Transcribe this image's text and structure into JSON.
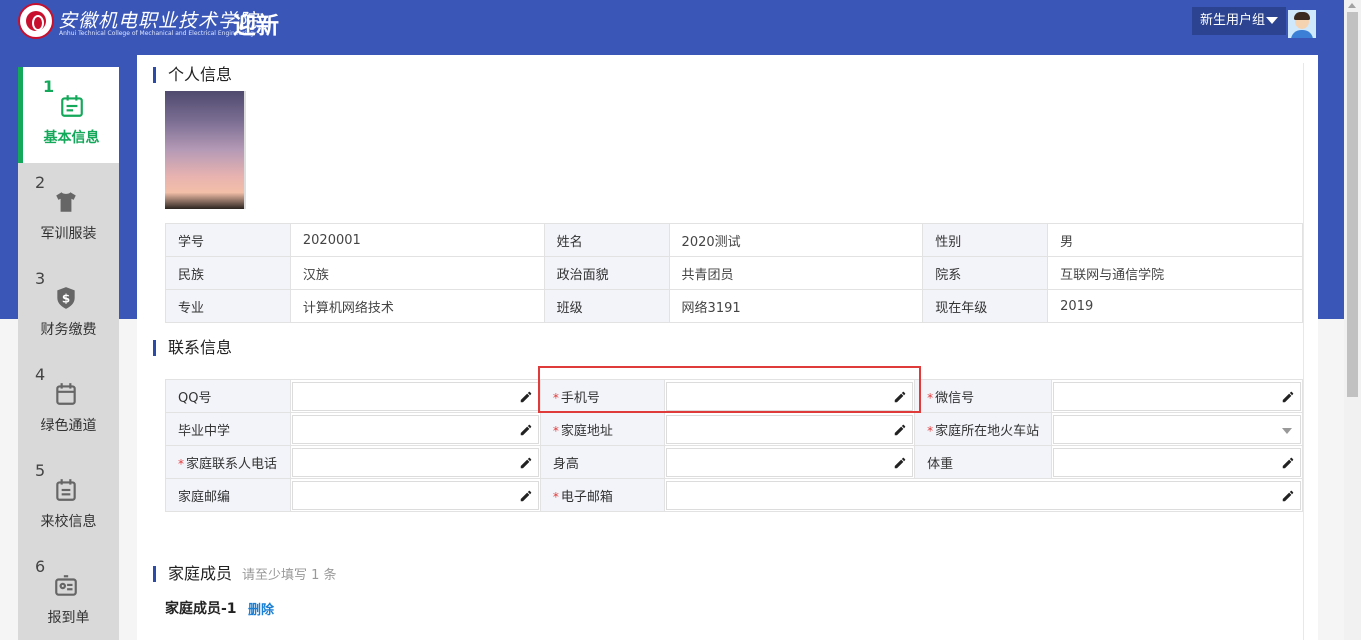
{
  "header": {
    "school_name": "安徽机电职业技术学院",
    "school_name_en": "Anhui Technical College of Mechanical and Electrical Engineering",
    "app_name": "迎新",
    "user_group": "新生用户组"
  },
  "sidebar": {
    "steps": [
      {
        "num": "1",
        "label": "基本信息",
        "icon": "calendar-edit-icon"
      },
      {
        "num": "2",
        "label": "军训服装",
        "icon": "tshirt-icon"
      },
      {
        "num": "3",
        "label": "财务缴费",
        "icon": "dollar-shield-icon"
      },
      {
        "num": "4",
        "label": "绿色通道",
        "icon": "calendar-icon"
      },
      {
        "num": "5",
        "label": "来校信息",
        "icon": "calendar-list-icon"
      },
      {
        "num": "6",
        "label": "报到单",
        "icon": "id-card-icon"
      }
    ]
  },
  "personal": {
    "title": "个人信息",
    "rows": [
      [
        {
          "label": "学号",
          "value": "2020001"
        },
        {
          "label": "姓名",
          "value": "2020测试"
        },
        {
          "label": "性别",
          "value": "男"
        }
      ],
      [
        {
          "label": "民族",
          "value": "汉族"
        },
        {
          "label": "政治面貌",
          "value": "共青团员"
        },
        {
          "label": "院系",
          "value": "互联网与通信学院"
        }
      ],
      [
        {
          "label": "专业",
          "value": "计算机网络技术"
        },
        {
          "label": "班级",
          "value": "网络3191"
        },
        {
          "label": "现在年级",
          "value": "2019"
        }
      ]
    ]
  },
  "contact": {
    "title": "联系信息",
    "qq": "QQ号",
    "phone": "手机号",
    "wechat": "微信号",
    "middle_school": "毕业中学",
    "home_address": "家庭地址",
    "home_station": "家庭所在地火车站",
    "home_contact_phone": "家庭联系人电话",
    "height": "身高",
    "weight": "体重",
    "postcode": "家庭邮编",
    "email": "电子邮箱"
  },
  "family": {
    "title": "家庭成员",
    "hint": "请至少填写 1 条",
    "member_title": "家庭成员-1",
    "delete": "删除"
  }
}
